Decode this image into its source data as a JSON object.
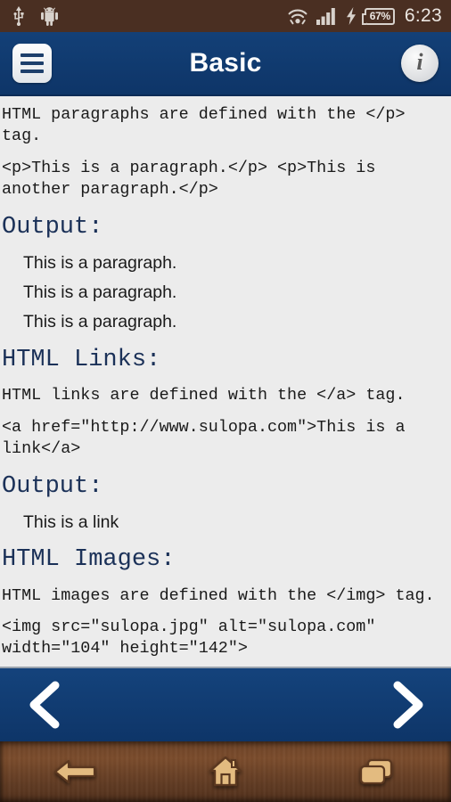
{
  "status_bar": {
    "icons": [
      "usb-icon",
      "android-robot-icon",
      "wifi-icon",
      "signal-icon",
      "charging-bolt-icon"
    ],
    "battery_percent": "67%",
    "time": "6:23",
    "background_color": "#4a2f22",
    "foreground_color": "#d8d2cc"
  },
  "title_bar": {
    "menu_icon": "hamburger-menu-icon",
    "title": "Basic",
    "info_icon": "info-icon",
    "info_glyph": "i",
    "background_color": "#103a6b",
    "title_color": "#ffffff"
  },
  "content": {
    "background_color": "#ececec",
    "heading_color": "#1b3158",
    "blocks": [
      {
        "kind": "code",
        "text": "HTML paragraphs are defined with the </p> tag."
      },
      {
        "kind": "code",
        "text": "<p>This is a paragraph.</p> <p>This is another paragraph.</p>"
      },
      {
        "kind": "heading",
        "text": "Output:"
      },
      {
        "kind": "outline",
        "text": "This is a paragraph."
      },
      {
        "kind": "outline",
        "text": "This is a paragraph."
      },
      {
        "kind": "outline",
        "text": "This is a paragraph."
      },
      {
        "kind": "heading",
        "text": "HTML Links:"
      },
      {
        "kind": "code",
        "text": "HTML links are defined with the </a> tag."
      },
      {
        "kind": "code",
        "text": "<a href=\"http://www.sulopa.com\">This is a link</a>"
      },
      {
        "kind": "heading",
        "text": "Output:"
      },
      {
        "kind": "outline",
        "text": "This is a link"
      },
      {
        "kind": "heading",
        "text": "HTML Images:"
      },
      {
        "kind": "code",
        "text": "HTML images are defined with the </img> tag."
      },
      {
        "kind": "code",
        "text": "<img src=\"sulopa.jpg\" alt=\"sulopa.com\" width=\"104\" height=\"142\">"
      }
    ]
  },
  "pager": {
    "previous_icon": "chevron-left-icon",
    "next_icon": "chevron-right-icon",
    "background_color": "#134077",
    "arrow_color": "#ffffff"
  },
  "android_nav_bar": {
    "back_icon": "back-arrow-icon",
    "home_icon": "home-icon",
    "recents_icon": "recent-apps-icon",
    "icon_color": "#e0b778",
    "background_color": "#6d4327"
  }
}
